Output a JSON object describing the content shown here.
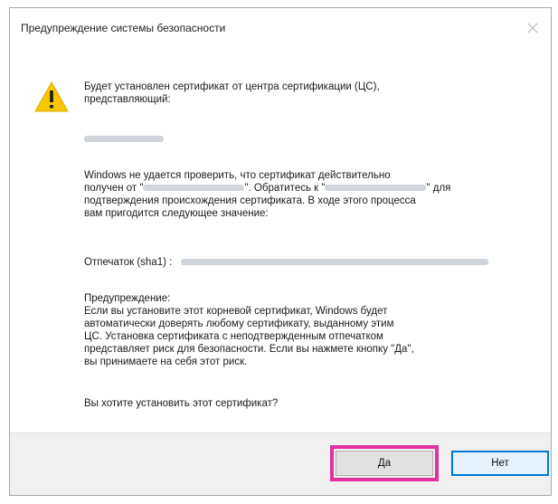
{
  "dialog": {
    "title": "Предупреждение системы безопасности",
    "close_icon": "close-icon",
    "warning_icon": "warning-triangle-icon",
    "intro_line1": "Будет установлен сертификат от центра сертификации (ЦС),",
    "intro_line2": "представляющий:",
    "verify_line1": "Windows не удается проверить, что сертификат действительно",
    "verify_line2_prefix": "получен от \"",
    "verify_line2_mid": "\". Обратитесь к \"",
    "verify_line2_suffix": "\" для",
    "verify_line3": "подтверждения происхождения сертификата. В ходе этого процесса",
    "verify_line4": "вам пригодится следующее значение:",
    "thumbprint_label": "Отпечаток (sha1) :",
    "warning_heading": "Предупреждение:",
    "warning_line1": "Если вы установите этот корневой сертификат, Windows будет",
    "warning_line2": "автоматически доверять любому сертификату, выданному этим",
    "warning_line3": "ЦС. Установка сертификата с неподтвержденным отпечатком",
    "warning_line4": "представляет риск для безопасности. Если вы нажмете кнопку \"Да\",",
    "warning_line5": "вы принимаете на себя этот риск.",
    "question": "Вы хотите установить этот сертификат?"
  },
  "buttons": {
    "yes_label": "Да",
    "no_label": "Нет"
  },
  "colors": {
    "highlight": "#e0329d",
    "focus": "#0078d7",
    "warning_yellow": "#f7c700"
  }
}
